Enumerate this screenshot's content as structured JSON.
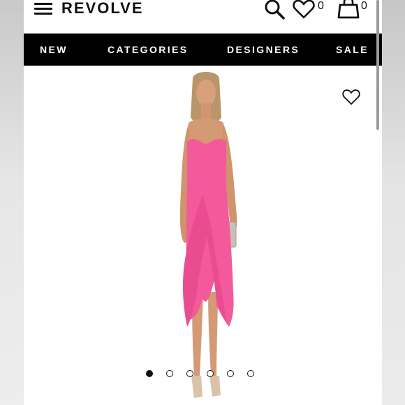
{
  "header": {
    "brand": "REVOLVE",
    "wishlist_count": "0",
    "bag_count": "0",
    "icons": [
      "menu-icon",
      "search-icon",
      "heart-icon",
      "bag-icon"
    ]
  },
  "nav": {
    "items": [
      "NEW",
      "CATEGORIES",
      "DESIGNERS",
      "SALE"
    ]
  },
  "product": {
    "image_icon": "product-photo-pink-strapless-ruffle-dress",
    "wishlist_icon": "heart-outline-icon",
    "gallery": {
      "total_images": 6,
      "active_index": 0
    }
  },
  "colors": {
    "nav_background": "#000000",
    "dress": "#f25a9c",
    "text": "#111111"
  }
}
